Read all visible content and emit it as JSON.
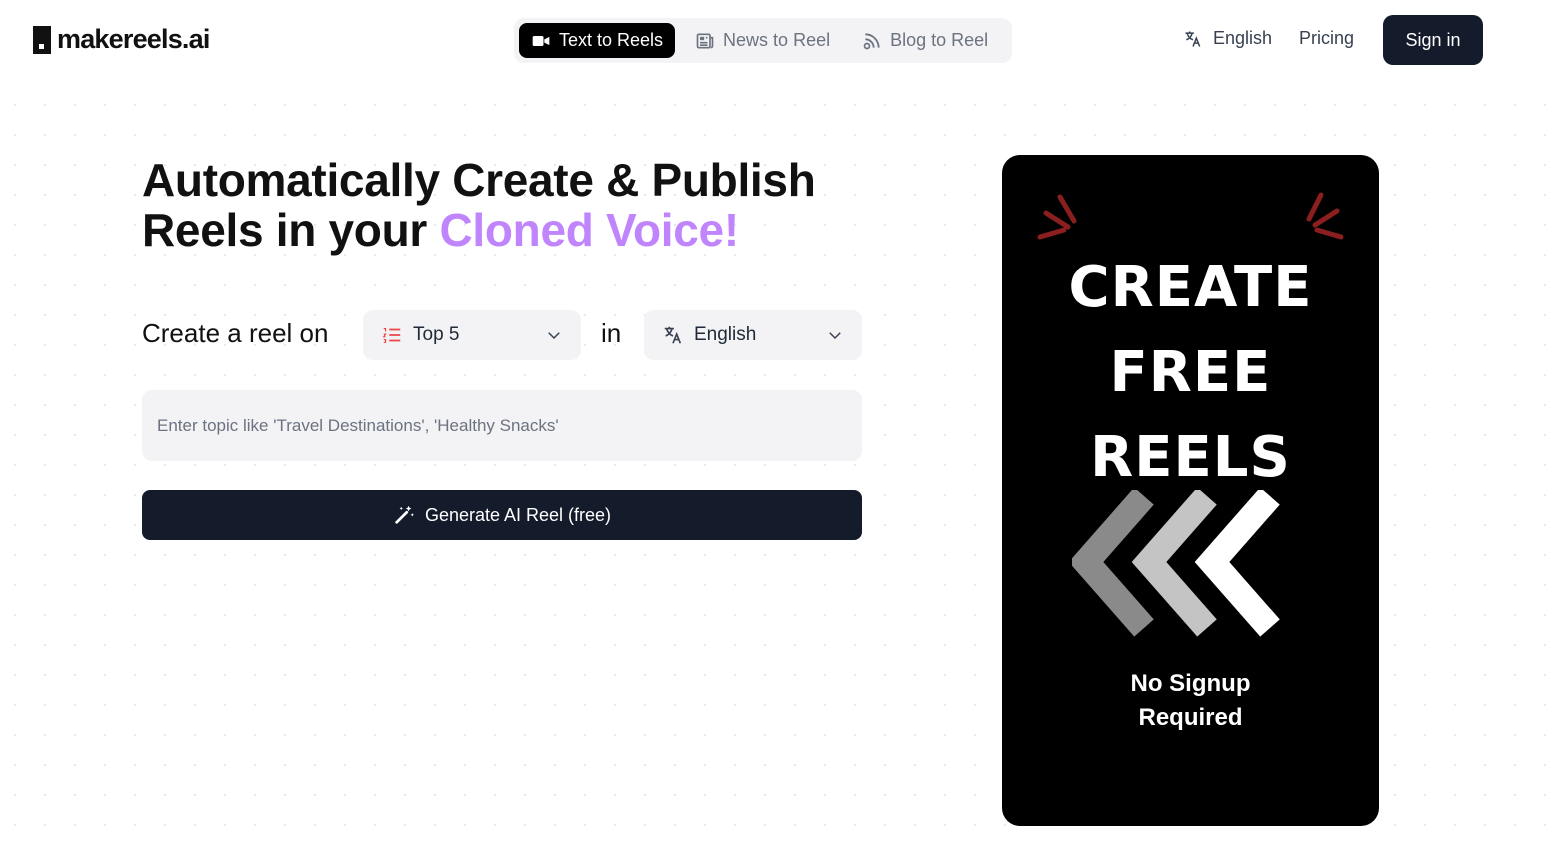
{
  "brand": {
    "name": "makereels.ai"
  },
  "tabs": [
    {
      "label": "Text to Reels",
      "icon": "video-icon",
      "active": true
    },
    {
      "label": "News to Reel",
      "icon": "newspaper-icon",
      "active": false
    },
    {
      "label": "Blog to Reel",
      "icon": "rss-icon",
      "active": false
    }
  ],
  "nav": {
    "language": "English",
    "pricing": "Pricing",
    "signin": "Sign in"
  },
  "hero": {
    "headline_line1": "Automatically Create & Publish",
    "headline_line2_prefix": "Reels in your ",
    "headline_accent": "Cloned Voice!",
    "accent_color": "#c084fc"
  },
  "form": {
    "create_label": "Create a reel on",
    "topic_select": "Top 5",
    "in_label": "in",
    "language_select": "English",
    "topic_placeholder": "Enter topic like 'Travel Destinations', 'Healthy Snacks'",
    "topic_value": "",
    "generate_label": "Generate AI Reel (free)"
  },
  "preview": {
    "line1": "CREATE",
    "line2": "FREE",
    "line3": "REELS",
    "sub1": "No Signup",
    "sub2": "Required",
    "spark_color": "#8b1e1e"
  },
  "colors": {
    "primary_dark": "#141b2b",
    "field_bg": "#f3f3f5"
  }
}
